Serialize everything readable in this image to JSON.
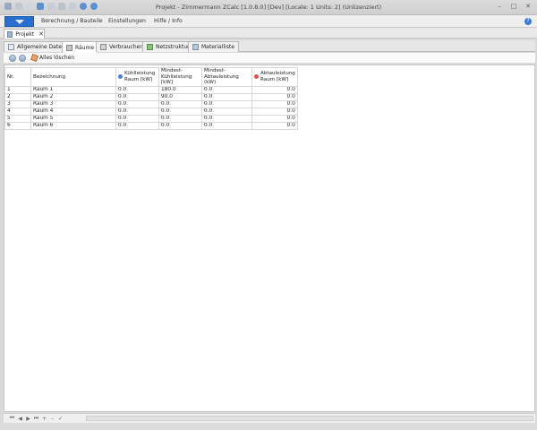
{
  "window": {
    "title": "Projekt - Zimmermann ZCalc [1.0.8.0] [Dev] [Locale: 1 Units: 2] (Unlizenziert)"
  },
  "menu": {
    "items": [
      "Berechnung / Bauteile",
      "Einstellungen",
      "Hilfe / Info"
    ]
  },
  "doc_tab": {
    "label": "Projekt"
  },
  "sub_tabs": [
    {
      "label": "Allgemeine Daten"
    },
    {
      "label": "Räume"
    },
    {
      "label": "Verbraucher"
    },
    {
      "label": "Netzstruktur"
    },
    {
      "label": "Materialliste"
    }
  ],
  "toolbar": {
    "delete_all_label": "Alles löschen"
  },
  "table": {
    "headers": {
      "nr": "Nr.",
      "name": "Bezeichnung",
      "cooling": "Kühlleistung Raum [kW]",
      "min_cooling": "Mindest-\nKühlleistung [kW]",
      "min_defrost": "Mindest-\nAbtauleistung (kW)",
      "defrost": "Abtauleistung Raum [kW]"
    },
    "rows": [
      {
        "nr": "1",
        "name": "Raum 1",
        "cooling": "0.0",
        "min_cooling": "180.0",
        "min_defrost": "0.0",
        "defrost": "0.0"
      },
      {
        "nr": "2",
        "name": "Raum 2",
        "cooling": "0.0",
        "min_cooling": "90.0",
        "min_defrost": "0.0",
        "defrost": "0.0"
      },
      {
        "nr": "3",
        "name": "Raum 3",
        "cooling": "0.0",
        "min_cooling": "0.0",
        "min_defrost": "0.0",
        "defrost": "0.0"
      },
      {
        "nr": "4",
        "name": "Raum 4",
        "cooling": "0.0",
        "min_cooling": "0.0",
        "min_defrost": "0.0",
        "defrost": "0.0"
      },
      {
        "nr": "5",
        "name": "Raum 5",
        "cooling": "0.0",
        "min_cooling": "0.0",
        "min_defrost": "0.0",
        "defrost": "0.0"
      },
      {
        "nr": "6",
        "name": "Raum 6",
        "cooling": "0.0",
        "min_cooling": "0.0",
        "min_defrost": "0.0",
        "defrost": "0.0"
      }
    ]
  },
  "colors": {
    "accent": "#2a6fcf",
    "cooling_dot": "#4f7fd6",
    "defrost_dot": "#e05050"
  }
}
